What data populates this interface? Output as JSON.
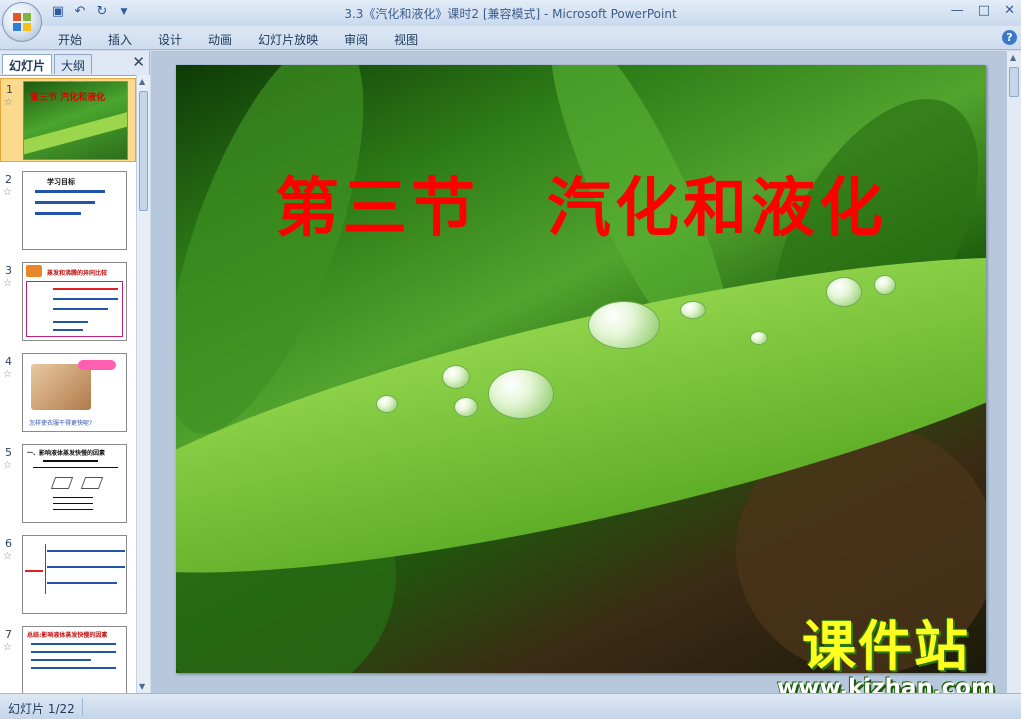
{
  "window": {
    "title": "3.3《汽化和液化》课时2 [兼容模式] - Microsoft PowerPoint",
    "controls": [
      "—",
      "□",
      "✕"
    ]
  },
  "quick_access": {
    "save_icon": "save-icon",
    "undo_icon": "undo-icon",
    "redo_icon": "redo-icon",
    "customize_icon": "customize-icon"
  },
  "ribbon": {
    "tabs": [
      "开始",
      "插入",
      "设计",
      "动画",
      "幻灯片放映",
      "审阅",
      "视图"
    ],
    "help_label": "?"
  },
  "left_pane": {
    "tab_slides": "幻灯片",
    "tab_outline": "大纲",
    "close_label": "✕",
    "slides": [
      {
        "num": "1",
        "title": "第三节 汽化和液化",
        "selected": true
      },
      {
        "num": "2",
        "title": "学习目标"
      },
      {
        "num": "3",
        "title": "蒸发和沸腾的异同比较"
      },
      {
        "num": "4",
        "title": "怎样使衣服干得更快呢?"
      },
      {
        "num": "5",
        "title": "一、影响液体蒸发快慢的因素"
      },
      {
        "num": "6",
        "title": ""
      },
      {
        "num": "7",
        "title": "总结:影响液体蒸发快慢的因素"
      }
    ]
  },
  "slide": {
    "title": "第三节　汽化和液化"
  },
  "watermark": {
    "name": "课件站",
    "url": "www.kjzhan.com"
  },
  "status": {
    "slide_counter": "幻灯片 1/22"
  },
  "colors": {
    "title_red": "#ff0000",
    "selection": "#fbd98d",
    "watermark_yellow": "#ffff20"
  }
}
